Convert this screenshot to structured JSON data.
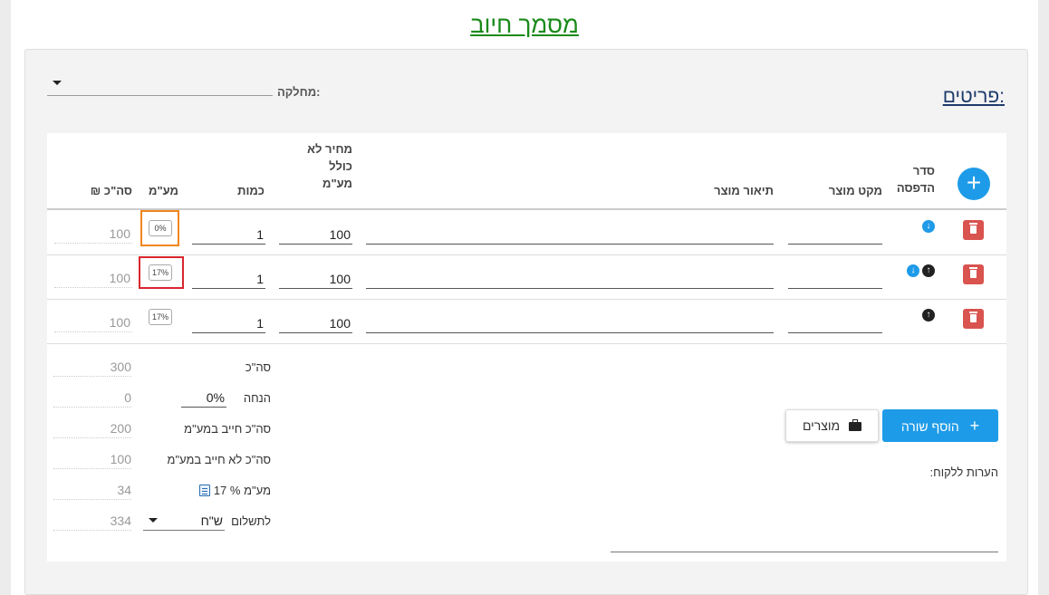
{
  "page": {
    "title": "מסמך חיוב"
  },
  "items": {
    "title": "פריטים:"
  },
  "department": {
    "label": "מחלקה:",
    "value": ""
  },
  "table": {
    "headers": {
      "order": "סדר הדפסה",
      "sku": "מקט מוצר",
      "description": "תיאור מוצר",
      "price": "מחיר לא כולל מע\"מ",
      "quantity": "כמות",
      "vat": "מע\"מ",
      "total": "סה\"כ ₪"
    },
    "rows": [
      {
        "sku": "",
        "description": "",
        "price": "100",
        "quantity": "1",
        "vat": "0%",
        "total": "100"
      },
      {
        "sku": "",
        "description": "",
        "price": "100",
        "quantity": "1",
        "vat": "17%",
        "total": "100"
      },
      {
        "sku": "",
        "description": "",
        "price": "100",
        "quantity": "1",
        "vat": "17%",
        "total": "100"
      }
    ]
  },
  "summary": {
    "total_label": "סה\"כ",
    "total_value": "300",
    "discount_label": "הנחה",
    "discount_input": "0%",
    "discount_value": "0",
    "vat_liable_label": "סה\"כ חייב במע\"מ",
    "vat_liable_value": "200",
    "vat_exempt_label": "סה\"כ לא חייב במע\"מ",
    "vat_exempt_value": "100",
    "vat_label": "מע\"מ % 17",
    "vat_value": "34",
    "pay_label": "לתשלום",
    "currency": "ש\"ח",
    "pay_value": "334"
  },
  "buttons": {
    "add_row": "הוסף שורה",
    "products": "מוצרים"
  },
  "comments": {
    "label": "הערות ללקוח:",
    "value": ""
  },
  "icons": {
    "add": "plus-circle-icon",
    "delete": "trash-icon",
    "down": "arrow-down-circle-icon",
    "up": "arrow-up-circle-icon",
    "products": "briefcase-icon",
    "vat_note": "edit-note-icon"
  },
  "colors": {
    "title": "#1a8a1a",
    "accent": "#1e9be8",
    "delete": "#d9534f",
    "highlight_orange": "#f0861e",
    "highlight_red": "#d9262e"
  }
}
